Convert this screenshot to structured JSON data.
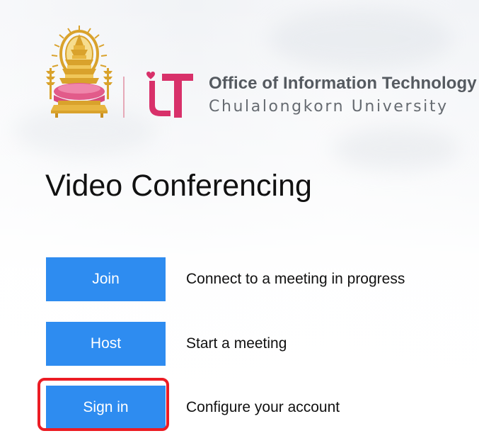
{
  "header": {
    "org_name": "Office of Information Technology",
    "org_sub": "Chulalongkorn University",
    "seal_icon": "chula-phra-kiao-seal-icon",
    "it_logo_icon": "it-logo-icon"
  },
  "main": {
    "title": "Video Conferencing",
    "actions": [
      {
        "label": "Join",
        "description": "Connect to a meeting in progress"
      },
      {
        "label": "Host",
        "description": "Start a meeting"
      },
      {
        "label": "Sign in",
        "description": "Configure your account"
      }
    ],
    "highlighted_action": "Sign in"
  },
  "colors": {
    "button_blue": "#2e8cf0",
    "highlight_red": "#ec1c24",
    "seal_gold": "#d9a22c",
    "seal_pink": "#e25b8a",
    "it_pink": "#d8316a",
    "org_text": "#555a60"
  }
}
